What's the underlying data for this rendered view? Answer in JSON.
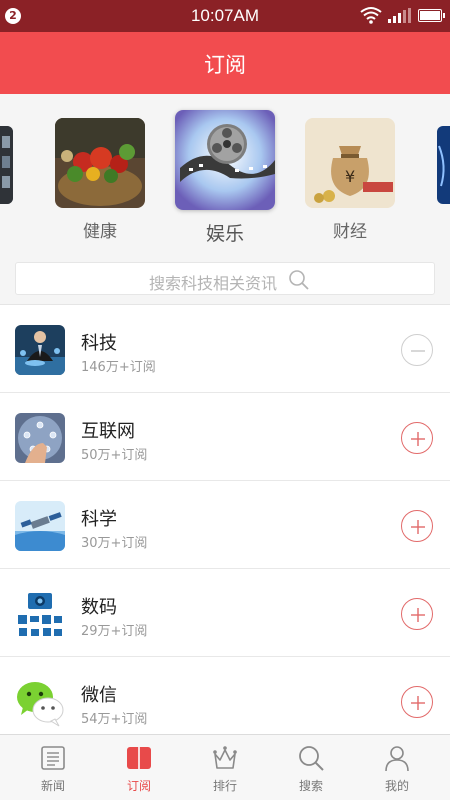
{
  "status_bar": {
    "notification_count": "2",
    "time": "10:07AM",
    "icons": [
      "wifi-icon",
      "signal-icon",
      "battery-icon"
    ]
  },
  "header": {
    "title": "订阅"
  },
  "carousel": {
    "items": [
      {
        "label": "健康",
        "icon": "vegetables-image"
      },
      {
        "label": "娱乐",
        "icon": "film-reel-image",
        "selected": true
      },
      {
        "label": "财经",
        "icon": "money-bag-image"
      }
    ]
  },
  "search": {
    "placeholder": "搜索科技相关资讯",
    "icon": "search-icon"
  },
  "channels": [
    {
      "name": "科技",
      "count": "146万+订阅",
      "subscribed": true,
      "icon": "tech-businessman-image"
    },
    {
      "name": "互联网",
      "count": "50万+订阅",
      "subscribed": false,
      "icon": "network-touch-image"
    },
    {
      "name": "科学",
      "count": "30万+订阅",
      "subscribed": false,
      "icon": "satellite-image"
    },
    {
      "name": "数码",
      "count": "29万+订阅",
      "subscribed": false,
      "icon": "digital-devices-image"
    },
    {
      "name": "微信",
      "count": "54万+订阅",
      "subscribed": false,
      "icon": "wechat-logo"
    }
  ],
  "tabbar": {
    "tabs": [
      {
        "label": "新闻",
        "icon": "news-icon"
      },
      {
        "label": "订阅",
        "icon": "book-icon",
        "active": true
      },
      {
        "label": "排行",
        "icon": "crown-icon"
      },
      {
        "label": "搜索",
        "icon": "search-icon"
      },
      {
        "label": "我的",
        "icon": "person-icon"
      }
    ]
  },
  "colors": {
    "status_bar": "#8b2126",
    "header": "#f24c4f",
    "accent": "#e84a4a"
  }
}
